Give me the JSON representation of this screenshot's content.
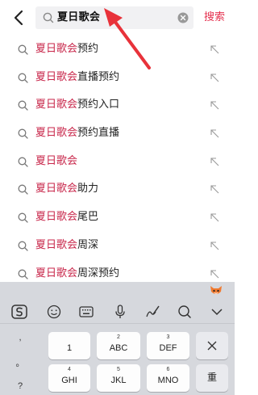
{
  "header": {
    "search_query": "夏日歌会",
    "search_button_label": "搜索"
  },
  "suggestions": [
    {
      "highlight": "夏日歌会",
      "rest": "预约"
    },
    {
      "highlight": "夏日歌会",
      "rest": "直播预约"
    },
    {
      "highlight": "夏日歌会",
      "rest": "预约入口"
    },
    {
      "highlight": "夏日歌会",
      "rest": "预约直播"
    },
    {
      "highlight": "夏日歌会",
      "rest": ""
    },
    {
      "highlight": "夏日歌会",
      "rest": "助力"
    },
    {
      "highlight": "夏日歌会",
      "rest": "尾巴"
    },
    {
      "highlight": "夏日歌会",
      "rest": "周深"
    },
    {
      "highlight": "夏日歌会",
      "rest": "周深预约"
    }
  ],
  "keyboard": {
    "toolbar_icons": [
      "sogou-logo-icon",
      "emoji-icon",
      "keyboard-icon",
      "microphone-icon",
      "handwriting-icon",
      "search-icon",
      "collapse-icon"
    ],
    "punctuation": [
      ",",
      "。",
      "?"
    ],
    "keys_row1": [
      {
        "num": "",
        "label": "1"
      },
      {
        "num": "2",
        "label": "ABC"
      },
      {
        "num": "3",
        "label": "DEF"
      }
    ],
    "keys_row2": [
      {
        "num": "4",
        "label": "GHI"
      },
      {
        "num": "5",
        "label": "JKL"
      },
      {
        "num": "6",
        "label": "MNO"
      }
    ],
    "reset_label": "重"
  },
  "colors": {
    "accent": "#e5304e",
    "highlight": "#c8264a",
    "annotation_arrow": "#e8323a",
    "keyboard_bg": "#d6d8dd"
  }
}
